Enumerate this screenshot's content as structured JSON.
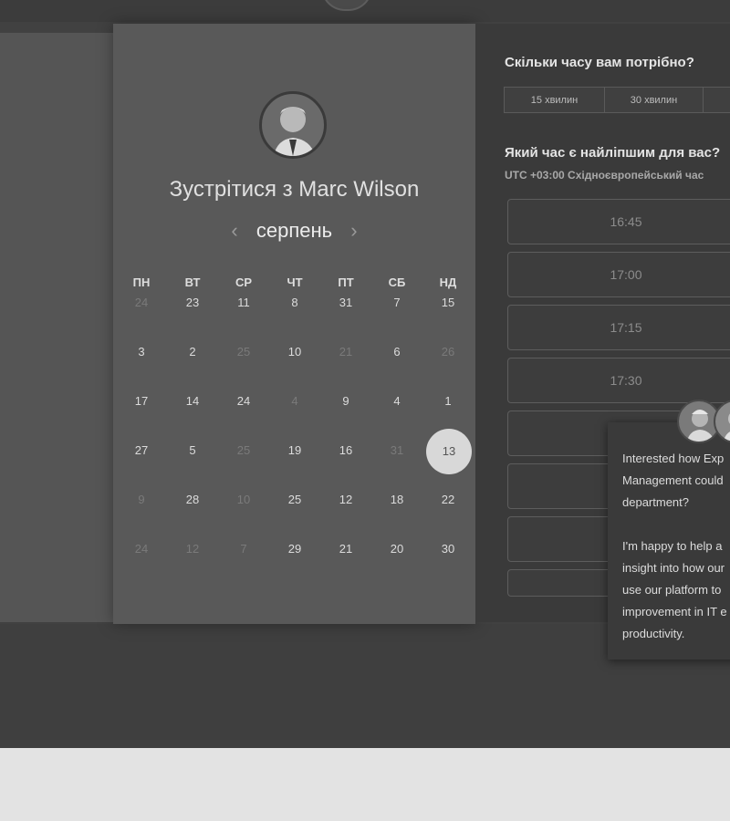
{
  "calendar": {
    "title": "Зустрітися з Marc Wilson",
    "month": "серпень",
    "prev_icon": "‹",
    "next_icon": "›",
    "weekdays": [
      "ПН",
      "ВТ",
      "СР",
      "ЧТ",
      "ПТ",
      "СБ",
      "НД"
    ],
    "weeks": [
      [
        "24",
        "23",
        "11",
        "8",
        "31",
        "7",
        "15"
      ],
      [
        "3",
        "2",
        "25",
        "10",
        "21",
        "6",
        "26"
      ],
      [
        "17",
        "14",
        "24",
        "4",
        "9",
        "4",
        "1"
      ],
      [
        "27",
        "5",
        "25",
        "19",
        "16",
        "31",
        "13"
      ],
      [
        "9",
        "28",
        "10",
        "25",
        "12",
        "18",
        "22"
      ],
      [
        "24",
        "12",
        "7",
        "29",
        "21",
        "20",
        "30"
      ]
    ],
    "selected": "13"
  },
  "booking": {
    "duration_question": "Скільки часу вам потрібно?",
    "durations": [
      "15 хвилин",
      "30 хвилин"
    ],
    "time_question": "Який час є найліпшим для вас?",
    "timezone": "UTC +03:00 Східноєвропейський час",
    "slots": [
      "16:45",
      "17:00",
      "17:15",
      "17:30",
      "",
      "",
      ""
    ]
  },
  "chat": {
    "message": "Interested how Exp\nManagement could\ndepartment?\n\nI'm happy to help a\ninsight into how our\nuse our platform to\nimprovement in IT e\nproductivity."
  },
  "colors": {
    "page_bg": "#414141",
    "calendar_panel": "#595959",
    "selected_day": "#d8d8d8",
    "footer_bg": "#e3e3e3"
  }
}
